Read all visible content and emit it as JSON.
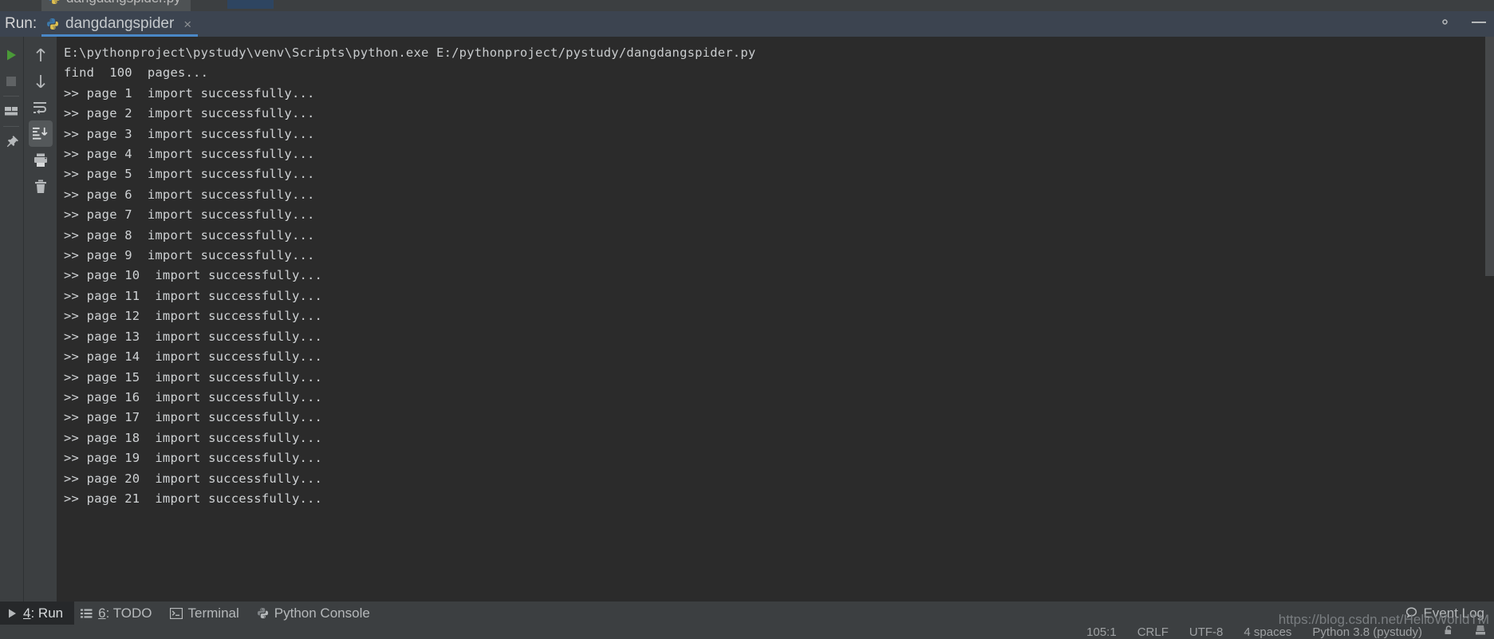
{
  "colors": {
    "run_green": "#4a9a38",
    "tab_accent": "#4a88c7",
    "console_bg": "#2b2b2b",
    "chrome_bg": "#3c3f41",
    "header_bg": "#3c4450",
    "text": "#cfd2d4",
    "muted_text": "#9ea1a3",
    "active_tab_bg": "#26282a"
  },
  "editor_tab": {
    "label": "dangdangspider.py",
    "icon": "python-file-icon"
  },
  "tool_window": {
    "title": "Run:",
    "tab": {
      "label": "dangdangspider",
      "icon": "python-file-icon",
      "close_label": "×"
    },
    "header_actions": [
      {
        "name": "settings-icon",
        "label": "Settings"
      },
      {
        "name": "hide-icon",
        "label": "Hide"
      }
    ]
  },
  "run_toolbar": {
    "buttons": [
      {
        "name": "rerun-button",
        "icon": "play-icon",
        "label": "Rerun"
      },
      {
        "name": "stop-button",
        "icon": "stop-icon",
        "label": "Stop"
      },
      {
        "name": "layout-button",
        "icon": "layout-icon",
        "label": "Layout Settings"
      },
      {
        "name": "pin-button",
        "icon": "pin-icon",
        "label": "Pin Tab"
      }
    ]
  },
  "console_toolbar": {
    "buttons": [
      {
        "name": "up-button",
        "icon": "arrow-up-icon",
        "label": "Up the Stack Trace"
      },
      {
        "name": "down-button",
        "icon": "arrow-down-icon",
        "label": "Down the Stack Trace"
      },
      {
        "name": "soft-wrap-button",
        "icon": "soft-wrap-icon",
        "label": "Use Soft Wraps",
        "active": false
      },
      {
        "name": "scroll-to-end-button",
        "icon": "scroll-to-end-icon",
        "label": "Scroll to the End",
        "active": true
      },
      {
        "name": "print-button",
        "icon": "print-icon",
        "label": "Print"
      },
      {
        "name": "clear-all-button",
        "icon": "trash-icon",
        "label": "Clear All"
      }
    ]
  },
  "console": {
    "command_line": "E:\\pythonproject\\pystudy\\venv\\Scripts\\python.exe E:/pythonproject/pystudy/dangdangspider.py",
    "lines": [
      "find  100  pages...",
      ">> page 1  import successfully...",
      ">> page 2  import successfully...",
      ">> page 3  import successfully...",
      ">> page 4  import successfully...",
      ">> page 5  import successfully...",
      ">> page 6  import successfully...",
      ">> page 7  import successfully...",
      ">> page 8  import successfully...",
      ">> page 9  import successfully...",
      ">> page 10  import successfully...",
      ">> page 11  import successfully...",
      ">> page 12  import successfully...",
      ">> page 13  import successfully...",
      ">> page 14  import successfully...",
      ">> page 15  import successfully...",
      ">> page 16  import successfully...",
      ">> page 17  import successfully...",
      ">> page 18  import successfully...",
      ">> page 19  import successfully...",
      ">> page 20  import successfully...",
      ">> page 21  import successfully..."
    ]
  },
  "bottom_bar": {
    "items": [
      {
        "name": "tool-tab-run",
        "mnemonic": "4",
        "label": ": Run",
        "icon": "play-icon",
        "active": true
      },
      {
        "name": "tool-tab-todo",
        "mnemonic": "6",
        "label": ": TODO",
        "icon": "list-icon",
        "active": false
      },
      {
        "name": "tool-tab-terminal",
        "mnemonic": "",
        "label": "Terminal",
        "icon": "terminal-icon",
        "active": false
      },
      {
        "name": "tool-tab-python-console",
        "mnemonic": "",
        "label": "Python Console",
        "icon": "python-file-icon",
        "active": false
      }
    ],
    "event_log": {
      "label": "Event Log",
      "icon": "balloon-icon"
    }
  },
  "status_bar": {
    "caret_position": "105:1",
    "line_separator": "CRLF",
    "encoding": "UTF-8",
    "indent": "4 spaces",
    "interpreter": "Python 3.8 (pystudy)",
    "icons": [
      {
        "name": "lock-icon",
        "label": "Lock"
      },
      {
        "name": "inspection-icon",
        "label": "Inspections"
      }
    ]
  },
  "watermark": {
    "text": "https://blog.csdn.net/HelloWorldTM"
  }
}
